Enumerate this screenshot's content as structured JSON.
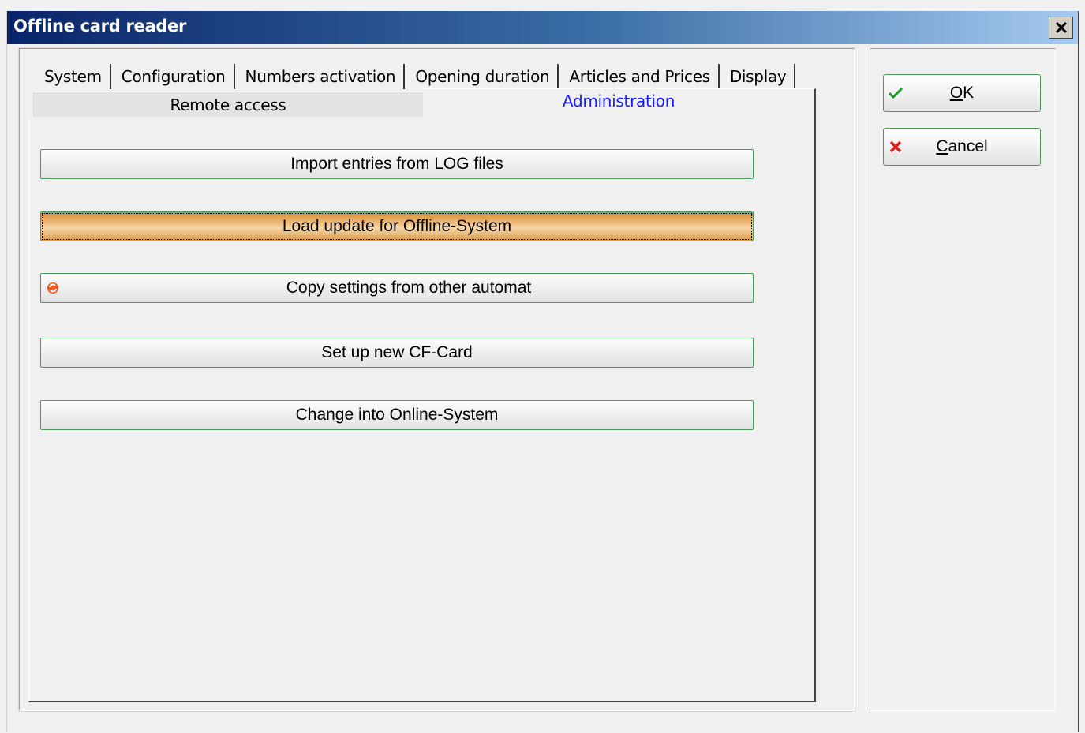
{
  "window": {
    "title": "Offline card reader",
    "close_glyph": "✕"
  },
  "tabs": {
    "row1": [
      "System",
      "Configuration",
      "Numbers activation",
      "Opening duration",
      "Articles and Prices",
      "Display"
    ],
    "remote_access": "Remote access",
    "administration": "Administration",
    "active_color": "#1a1aff"
  },
  "actions": {
    "import_log": "Import entries from LOG files",
    "load_update": "Load update for Offline-System",
    "copy_settings": "Copy settings from other automat",
    "setup_cf": "Set up new CF-Card",
    "change_online": "Change into Online-System"
  },
  "side": {
    "ok_prefix": "",
    "ok_mnemonic": "O",
    "ok_rest": "K",
    "cancel_mnemonic": "C",
    "cancel_rest": "ancel"
  },
  "icons": {
    "ok": "checkmark-icon",
    "cancel": "red-x-icon",
    "copy": "orange-arrows-icon",
    "close": "close-icon"
  }
}
